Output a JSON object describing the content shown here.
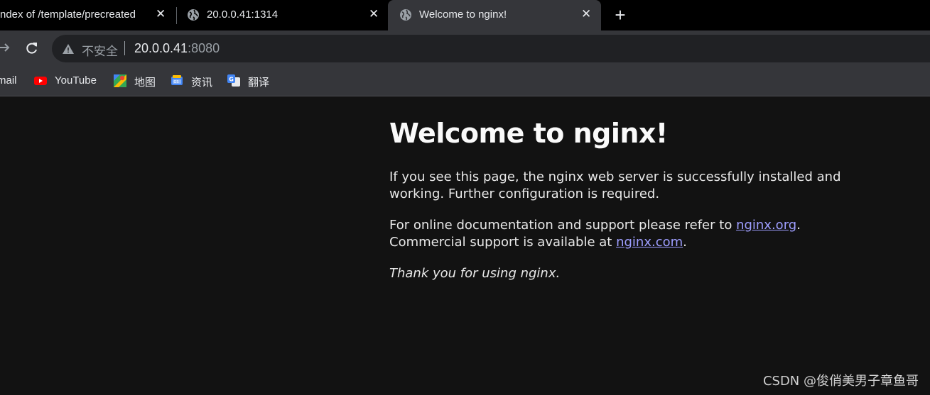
{
  "tabs": [
    {
      "title": "ndex of /template/precreated",
      "close": "✕"
    },
    {
      "title": "20.0.0.41:1314",
      "close": "✕"
    },
    {
      "title": "Welcome to nginx!",
      "close": "✕"
    }
  ],
  "new_tab": "+",
  "address_bar": {
    "security_label": "不安全",
    "url_host": "20.0.0.41",
    "url_port": ":8080"
  },
  "bookmarks": [
    {
      "label": "mail",
      "icon": "gmail-icon"
    },
    {
      "label": "YouTube",
      "icon": "youtube-icon"
    },
    {
      "label": "地图",
      "icon": "maps-icon"
    },
    {
      "label": "资讯",
      "icon": "news-icon"
    },
    {
      "label": "翻译",
      "icon": "translate-icon"
    }
  ],
  "page": {
    "heading": "Welcome to nginx!",
    "p1": "If you see this page, the nginx web server is successfully installed and working. Further configuration is required.",
    "p2_before": "For online documentation and support please refer to ",
    "p2_link1": "nginx.org",
    "p2_mid": ".",
    "p2_line2": "Commercial support is available at ",
    "p2_link2": "nginx.com",
    "p2_end": ".",
    "p3": "Thank you for using nginx."
  },
  "watermark": "CSDN @俊俏美男子章鱼哥",
  "colors": {
    "tab_strip": "#000000",
    "toolbar": "#35363a",
    "page_bg": "#121212",
    "link": "#9e9eff"
  }
}
